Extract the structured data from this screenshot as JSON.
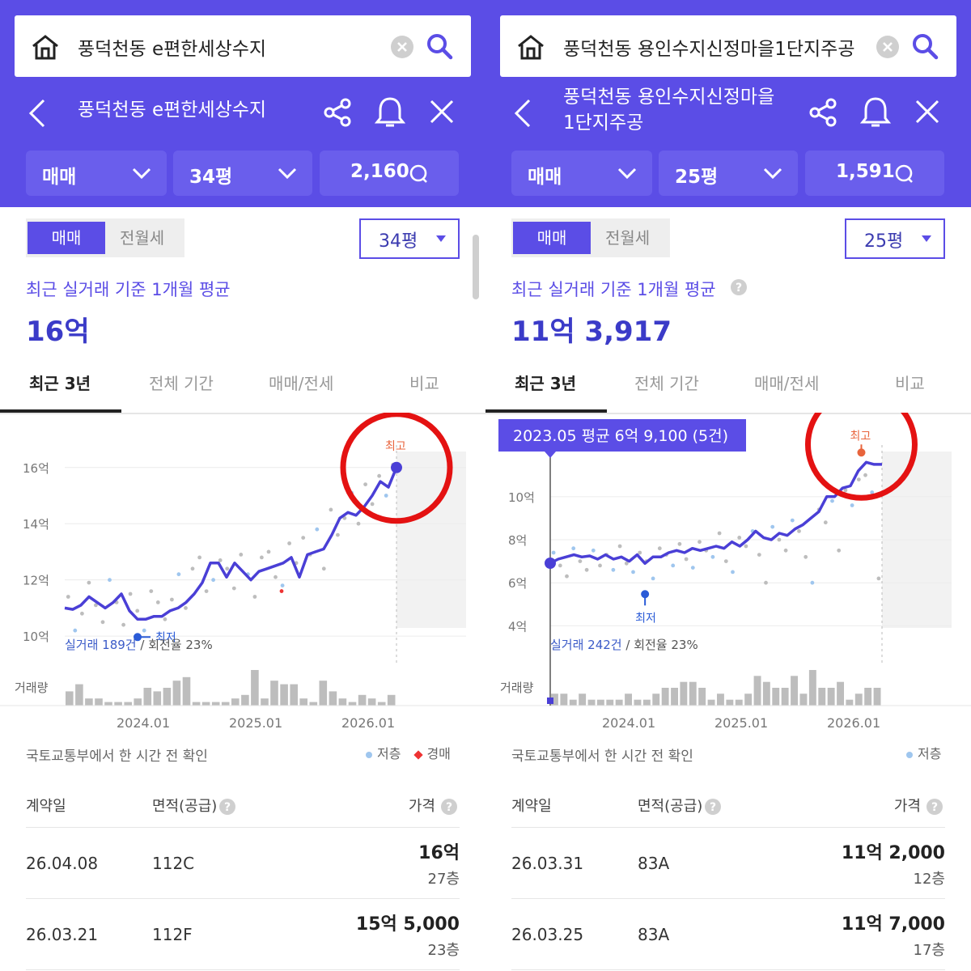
{
  "panels": [
    {
      "search_query": "풍덕천동 e편한세상수지",
      "title": "풍덕천동 e편한세상수지",
      "title_lines": [
        "풍덕천동 e편한세상수지"
      ],
      "filters": {
        "trade_type": "매매",
        "size": "34평",
        "count": "2,160"
      },
      "segment": {
        "active": "매매",
        "inactive": "전월세"
      },
      "size_select": "34평",
      "avg_caption": "최근 실거래 기준 1개월 평균",
      "avg_value": "16억",
      "tabs": [
        "최근 3년",
        "전체 기간",
        "매매/전세",
        "비교"
      ],
      "source_note": "국토교통부에서 한 시간 전 확인",
      "legend": {
        "low_floor": "저층",
        "auction": "경매"
      },
      "table_headers": {
        "date": "계약일",
        "area": "면적(공급)",
        "price": "가격"
      },
      "rows": [
        {
          "date": "26.04.08",
          "area": "112C",
          "price": "16억",
          "floor": "27층"
        },
        {
          "date": "26.03.21",
          "area": "112F",
          "price": "15억 5,000",
          "floor": "23층"
        }
      ],
      "chart_data": {
        "type": "line",
        "y_ticks": [
          "16억",
          "14억",
          "12억",
          "10억"
        ],
        "y_tick_values": [
          16,
          14,
          12,
          10
        ],
        "ylim": [
          9.6,
          16.8
        ],
        "x_ticks": [
          "2024.01",
          "2025.01",
          "2026.01"
        ],
        "volume_label": "거래량",
        "summary": {
          "count_text": "실거래 189건",
          "turnover_text": " / 회전율 23%"
        },
        "max_label": "최고",
        "min_label": "최저",
        "series": [
          {
            "values": [
              11.0,
              10.95,
              11.1,
              11.4,
              11.2,
              11.0,
              11.2,
              11.5,
              10.9,
              10.6,
              10.6,
              10.7,
              10.7,
              10.9,
              11.0,
              11.2,
              11.5,
              11.9,
              12.6,
              12.6,
              12.1,
              12.6,
              12.3,
              12.0,
              12.3,
              12.4,
              12.5,
              12.6,
              12.8,
              12.1,
              12.9,
              13.0,
              13.1,
              13.6,
              14.2,
              14.4,
              14.3,
              14.6,
              15.0,
              15.5,
              15.3,
              16.0
            ]
          }
        ],
        "scatter_values": [
          11.4,
          10.2,
          10.8,
          11.9,
          11.1,
          10.5,
          12.0,
          11.2,
          10.4,
          11.5,
          10.9,
          10.2,
          11.6,
          11.2,
          10.6,
          11.3,
          12.2,
          11.0,
          12.4,
          12.8,
          11.6,
          12.0,
          12.7,
          12.4,
          11.7,
          12.9,
          12.2,
          11.4,
          12.8,
          13.0,
          12.1,
          11.8,
          13.3,
          12.6,
          13.5,
          12.9,
          13.8,
          12.4,
          14.5,
          13.6,
          14.2,
          15.1,
          14.0,
          15.4,
          14.7,
          15.7,
          15.0,
          16.1
        ],
        "volumes": [
          4,
          6,
          2,
          2,
          1,
          1,
          1,
          2,
          5,
          4,
          5,
          7,
          8,
          1,
          1,
          1,
          1,
          2,
          3,
          10,
          2,
          7,
          6,
          6,
          2,
          1,
          7,
          4,
          2,
          1,
          3,
          2,
          1,
          3
        ],
        "min_index": 9,
        "max_index": 41
      }
    },
    {
      "search_query": "풍덕천동 용인수지신정마을1단지주공",
      "title": "풍덕천동 용인수지신정마을 1단지주공",
      "title_lines": [
        "풍덕천동 용인수지신정마을",
        "1단지주공"
      ],
      "filters": {
        "trade_type": "매매",
        "size": "25평",
        "count": "1,591"
      },
      "segment": {
        "active": "매매",
        "inactive": "전월세"
      },
      "size_select": "25평",
      "avg_caption": "최근 실거래 기준 1개월 평균",
      "avg_value": "11억 3,917",
      "tabs": [
        "최근 3년",
        "전체 기간",
        "매매/전세",
        "비교"
      ],
      "source_note": "국토교통부에서 한 시간 전 확인",
      "legend": {
        "low_floor": "저층"
      },
      "table_headers": {
        "date": "계약일",
        "area": "면적(공급)",
        "price": "가격"
      },
      "rows": [
        {
          "date": "26.03.31",
          "area": "83A",
          "price": "11억 2,000",
          "floor": "12층"
        },
        {
          "date": "26.03.25",
          "area": "83A",
          "price": "11억 7,000",
          "floor": "17층"
        }
      ],
      "chart_data": {
        "type": "line",
        "y_ticks": [
          "10억",
          "8억",
          "6억",
          "4억"
        ],
        "y_tick_values": [
          10,
          8,
          6,
          4
        ],
        "ylim": [
          3.0,
          12.4
        ],
        "x_ticks": [
          "2024.01",
          "2025.01",
          "2026.01"
        ],
        "volume_label": "거래량",
        "summary": {
          "count_text": "실거래 242건",
          "turnover_text": " / 회전율 23%"
        },
        "tooltip": "2023.05 평균 6억 9,100 (5건)",
        "max_label": "최고",
        "min_label": "최저",
        "series": [
          {
            "values": [
              6.91,
              7.1,
              7.2,
              7.3,
              7.2,
              7.25,
              7.1,
              7.3,
              7.1,
              7.2,
              7.0,
              7.3,
              6.9,
              7.2,
              7.2,
              7.4,
              7.5,
              7.4,
              7.6,
              7.5,
              7.6,
              7.7,
              7.6,
              7.9,
              7.7,
              8.0,
              8.4,
              8.1,
              8.0,
              8.3,
              8.2,
              8.5,
              8.7,
              9.0,
              9.3,
              10.0,
              10.0,
              10.4,
              10.5,
              11.2,
              11.6,
              11.5,
              11.5
            ]
          }
        ],
        "scatter_values": [
          7.4,
          6.8,
          6.3,
          7.6,
          7.0,
          6.6,
          7.5,
          6.8,
          7.3,
          6.6,
          7.7,
          6.9,
          6.5,
          7.4,
          7.0,
          6.2,
          7.6,
          7.3,
          6.8,
          7.8,
          7.1,
          6.7,
          7.9,
          7.5,
          7.2,
          8.3,
          7.0,
          6.5,
          8.1,
          7.7,
          8.4,
          7.3,
          6.0,
          8.6,
          8.0,
          7.5,
          8.9,
          8.4,
          7.2,
          6.0,
          9.4,
          8.8,
          9.8,
          7.5,
          10.3,
          9.6,
          10.8,
          11.0,
          10.2,
          6.2
        ],
        "volumes": [
          2,
          2,
          1,
          2,
          1,
          1,
          1,
          1,
          2,
          1,
          1,
          2,
          3,
          3,
          4,
          4,
          3,
          1,
          2,
          1,
          1,
          2,
          5,
          4,
          3,
          3,
          5,
          2,
          6,
          3,
          3,
          4,
          1,
          2,
          3,
          3
        ],
        "min_index": 12,
        "max_index": 40
      }
    }
  ]
}
